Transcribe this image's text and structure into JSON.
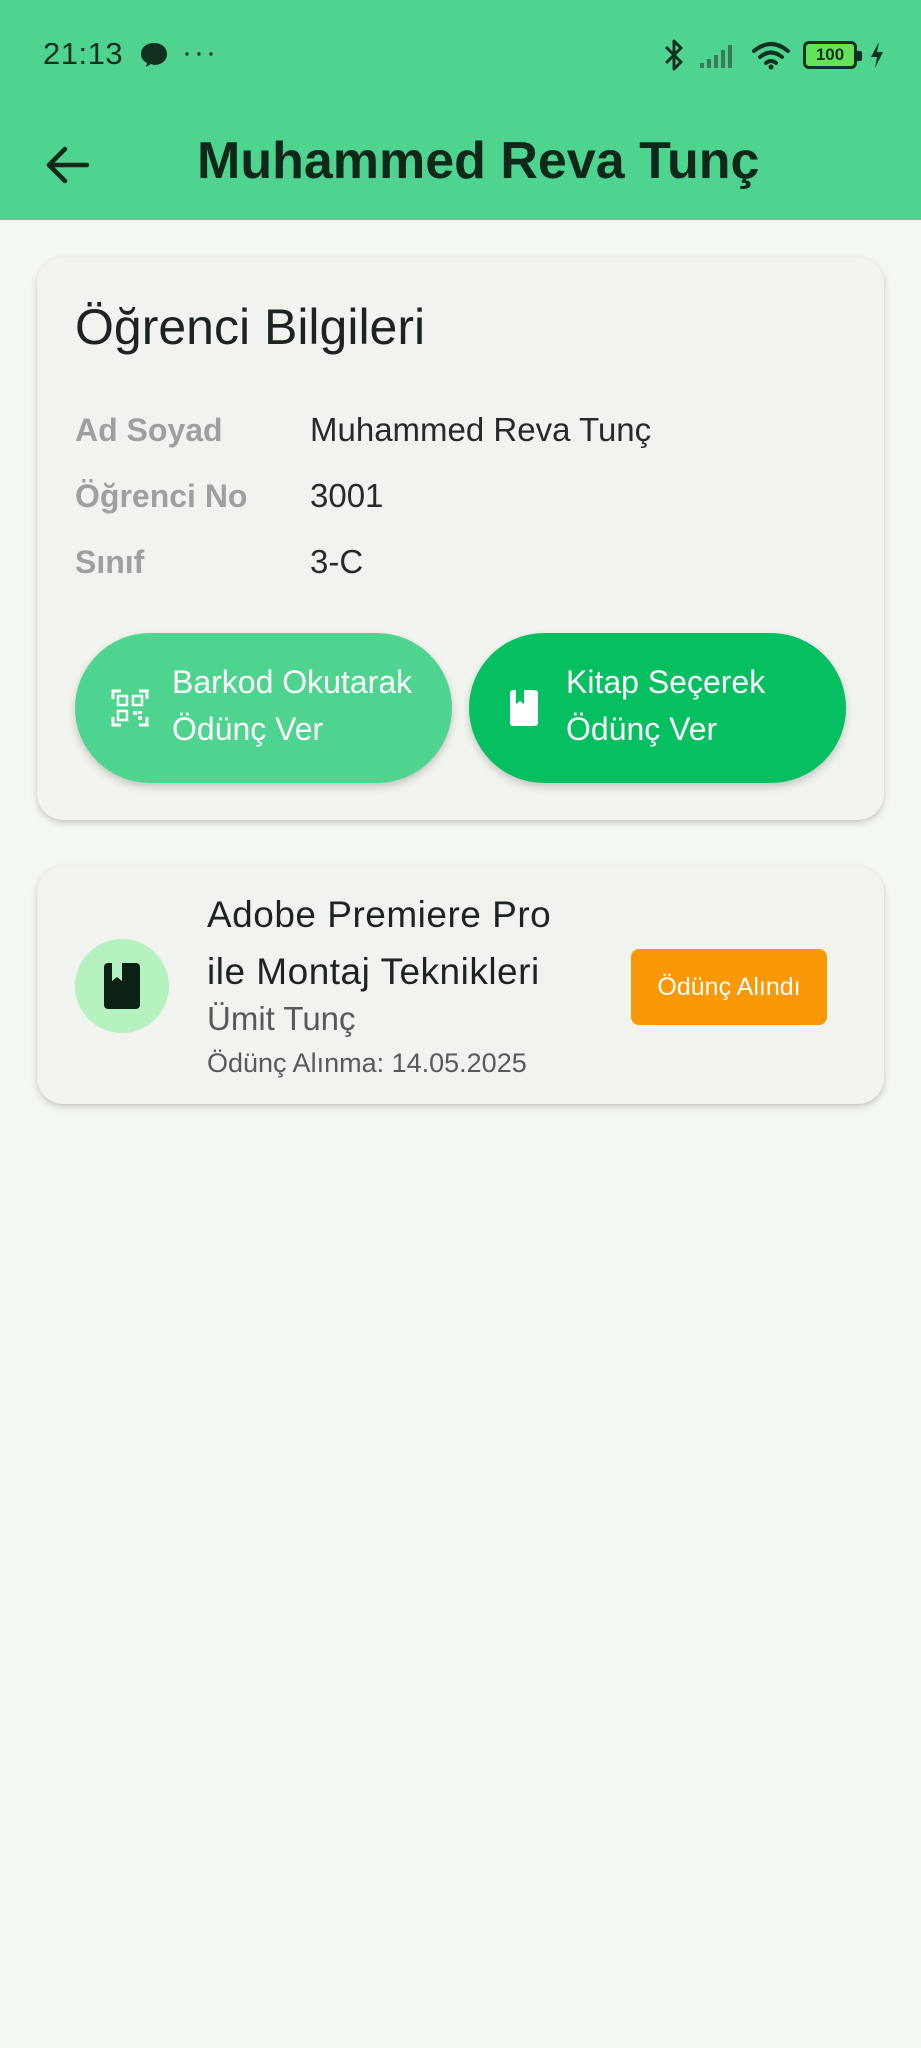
{
  "status_bar": {
    "time": "21:13",
    "more": "···",
    "battery": "100"
  },
  "app_bar": {
    "title": "Muhammed Reva Tunç"
  },
  "student_info": {
    "heading": "Öğrenci Bilgileri",
    "rows": [
      {
        "label": "Ad Soyad",
        "value": "Muhammed Reva Tunç"
      },
      {
        "label": "Öğrenci No",
        "value": "3001"
      },
      {
        "label": "Sınıf",
        "value": "3-C"
      }
    ],
    "buttons": {
      "barcode": {
        "line1": "Barkod Okutarak",
        "line2": "Ödünç Ver",
        "icon": "qr-code-scanner-icon"
      },
      "select": {
        "line1": "Kitap Seçerek",
        "line2": "Ödünç Ver",
        "icon": "book-icon"
      }
    }
  },
  "loans": [
    {
      "title_line1": "Adobe Premiere Pro",
      "title_line2": "ile Montaj Teknikleri",
      "author": "Ümit Tunç",
      "date": "Ödünç Alınma: 14.05.2025",
      "status": "Ödünç Alındı",
      "icon": "book-icon"
    }
  ],
  "colors": {
    "header": "#4fd48f",
    "primary_button": "#06bf60",
    "secondary_button": "#4fd48f",
    "status_badge": "#fb9808",
    "avatar_bg": "#b6f1c0",
    "background": "#f4f8f2"
  }
}
